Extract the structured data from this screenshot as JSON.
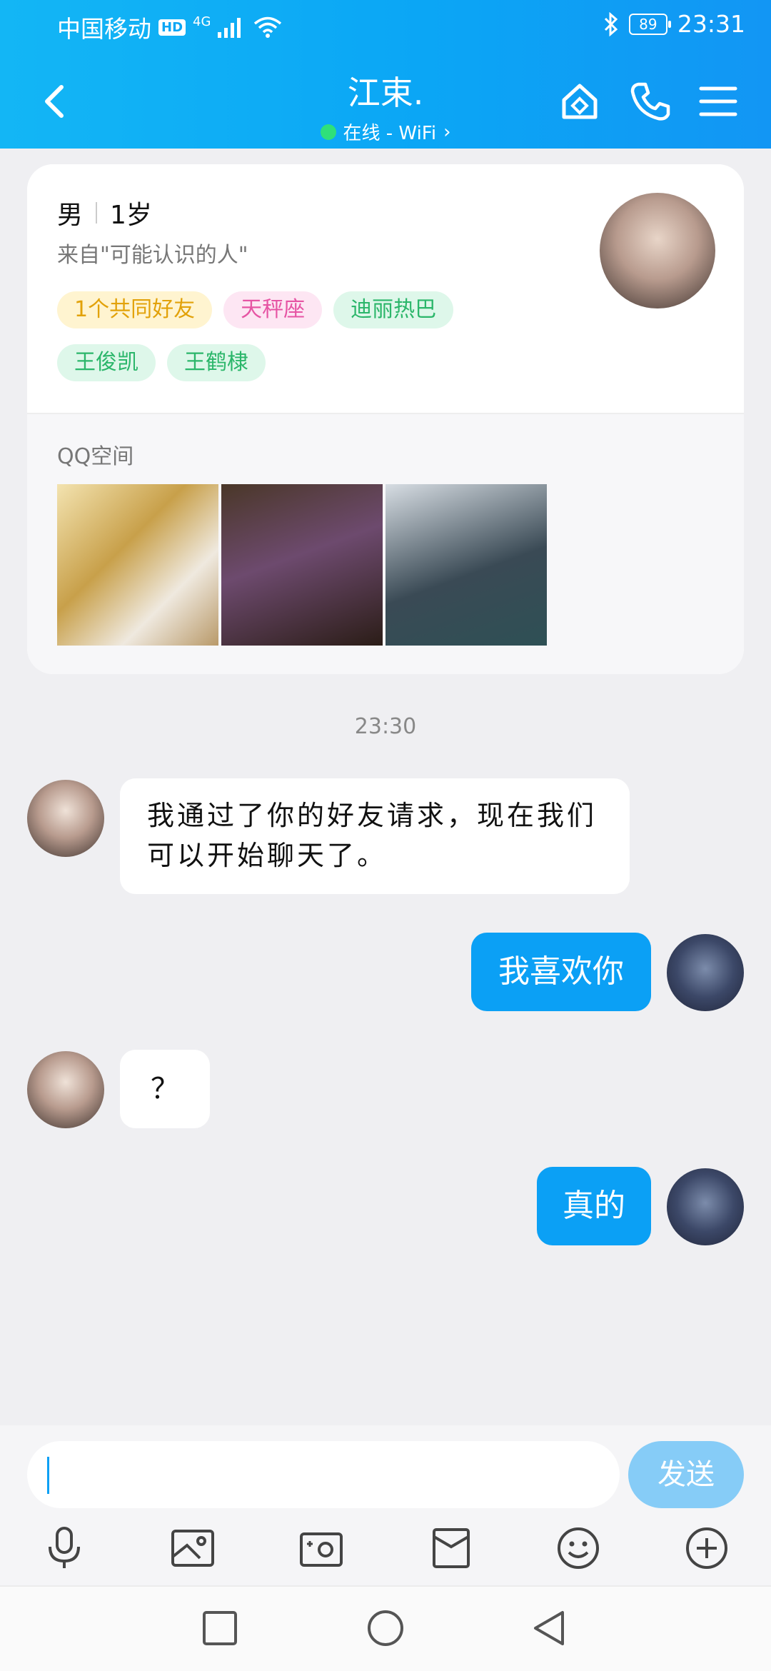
{
  "status_bar": {
    "carrier": "中国移动",
    "hd": "HD",
    "network": "4G",
    "battery": "89",
    "time": "23:31"
  },
  "header": {
    "title": "江束.",
    "online_status": "在线 - WiFi",
    "chevron": "›"
  },
  "profile": {
    "gender": "男",
    "age": "1岁",
    "source": "来自\"可能认识的人\"",
    "tags": [
      "1个共同好友",
      "天秤座",
      "迪丽热巴",
      "王俊凯",
      "王鹤棣"
    ],
    "space_title": "QQ空间"
  },
  "chat": {
    "timestamp": "23:30",
    "messages": [
      {
        "from": "them",
        "text": "我通过了你的好友请求，现在我们可以开始聊天了。"
      },
      {
        "from": "me",
        "text": "我喜欢你"
      },
      {
        "from": "them",
        "text": "？"
      },
      {
        "from": "me",
        "text": "真的"
      }
    ]
  },
  "input": {
    "send_label": "发送"
  },
  "colors": {
    "header": "#0ba6f5",
    "bubble_out": "#0ba0f5",
    "send_disabled": "#86ccf7"
  },
  "icons": [
    "back-icon",
    "home-icon",
    "phone-icon",
    "menu-icon",
    "microphone-icon",
    "image-icon",
    "camera-icon",
    "file-icon",
    "emoji-icon",
    "plus-icon",
    "square-nav-icon",
    "circle-nav-icon",
    "triangle-nav-icon"
  ]
}
